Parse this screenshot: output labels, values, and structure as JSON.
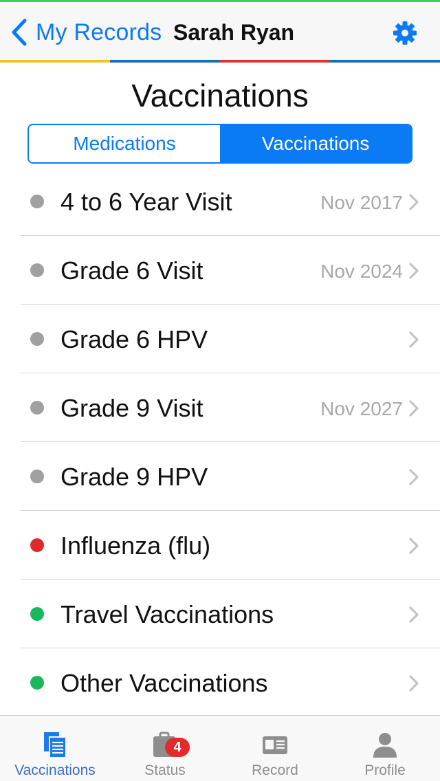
{
  "navbar": {
    "back_label": "My Records",
    "title": "Sarah Ryan",
    "accent_color": "#0a7af5"
  },
  "stripes": [
    "#f6c026",
    "#1a6db7",
    "#d9362c",
    "#1a6db7"
  ],
  "page": {
    "title": "Vaccinations"
  },
  "segments": [
    {
      "label": "Medications",
      "active": false
    },
    {
      "label": "Vaccinations",
      "active": true
    }
  ],
  "items": [
    {
      "label": "4 to 6 Year Visit",
      "date": "Nov 2017",
      "status_color": "#a0a0a0"
    },
    {
      "label": "Grade 6 Visit",
      "date": "Nov 2024",
      "status_color": "#a0a0a0"
    },
    {
      "label": "Grade 6 HPV",
      "date": "",
      "status_color": "#a0a0a0"
    },
    {
      "label": "Grade 9 Visit",
      "date": "Nov 2027",
      "status_color": "#a0a0a0"
    },
    {
      "label": "Grade 9 HPV",
      "date": "",
      "status_color": "#a0a0a0"
    },
    {
      "label": "Influenza (flu)",
      "date": "",
      "status_color": "#e02a2a"
    },
    {
      "label": "Travel Vaccinations",
      "date": "",
      "status_color": "#19b85a"
    },
    {
      "label": "Other Vaccinations",
      "date": "",
      "status_color": "#19b85a"
    }
  ],
  "tabbar": {
    "tabs": [
      {
        "label": "Vaccinations",
        "icon": "documents-icon",
        "selected": true
      },
      {
        "label": "Status",
        "icon": "clipboard-icon",
        "selected": false,
        "badge": "4"
      },
      {
        "label": "Record",
        "icon": "id-card-icon",
        "selected": false
      },
      {
        "label": "Profile",
        "icon": "person-icon",
        "selected": false
      }
    ]
  }
}
